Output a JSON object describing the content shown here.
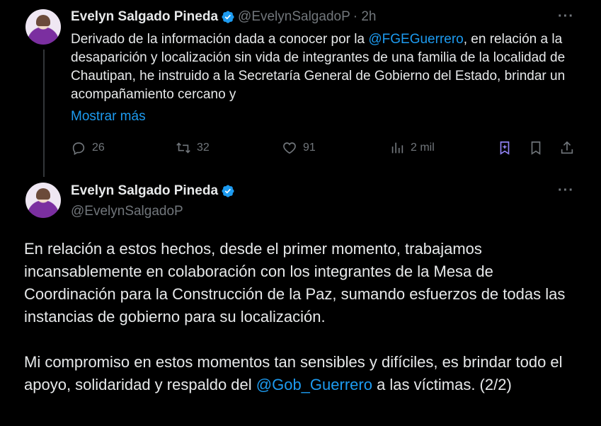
{
  "tweet1": {
    "author_name": "Evelyn Salgado Pineda",
    "handle": "@EvelynSalgadoP",
    "time": "· 2h",
    "text_before_mention": "Derivado de la información dada a conocer por la ",
    "mention": "@FGEGuerrero",
    "text_after_mention": ", en relación a la desaparición y localización sin vida de integrantes de una familia de la localidad de Chautipan, he instruido a la Secretaría General de Gobierno del Estado, brindar un acompañamiento cercano y",
    "show_more": "Mostrar más",
    "more_label": "···",
    "replies": "26",
    "retweets": "32",
    "likes": "91",
    "views": "2 mil"
  },
  "tweet2": {
    "author_name": "Evelyn Salgado Pineda",
    "handle": "@EvelynSalgadoP",
    "more_label": "···",
    "paragraph1": "En relación a estos hechos, desde el primer momento, trabajamos incansablemente en colaboración con los integrantes de la Mesa de Coordinación para la Construcción de la Paz, sumando esfuerzos de todas las instancias de gobierno para su localización.",
    "paragraph2_before_mention": "Mi compromiso en estos momentos tan sensibles y difíciles, es brindar todo el apoyo, solidaridad y respaldo del ",
    "paragraph2_mention": "@Gob_Guerrero",
    "paragraph2_after_mention": " a las víctimas. (2/2)"
  },
  "icons": {
    "verified": "verified-badge-icon",
    "reply": "reply-icon",
    "retweet": "retweet-icon",
    "like": "heart-icon",
    "views": "views-chart-icon",
    "grok": "grok-icon",
    "bookmark": "bookmark-icon",
    "share": "share-icon"
  },
  "colors": {
    "accent": "#1d9bf0",
    "muted": "#71767b",
    "text": "#e7e9ea",
    "grok": "#9385f7"
  }
}
